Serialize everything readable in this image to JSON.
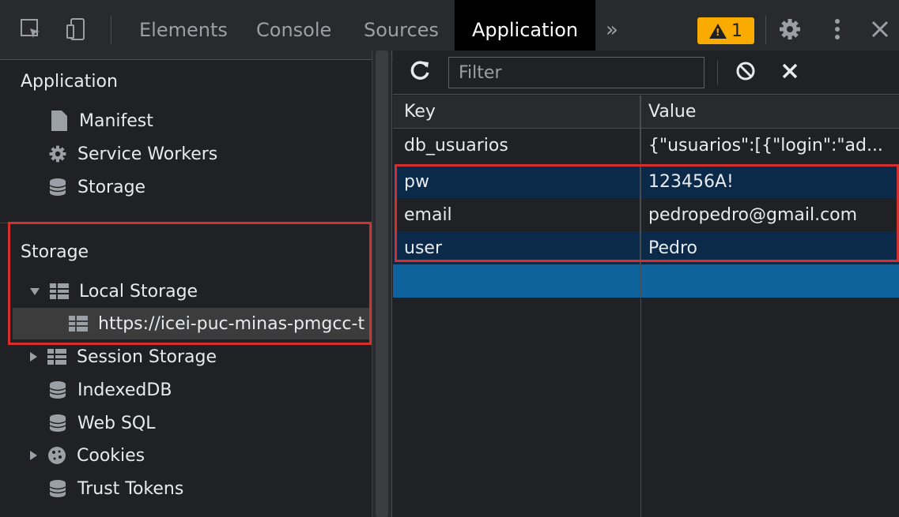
{
  "tabs": {
    "elements": "Elements",
    "console": "Console",
    "sources": "Sources",
    "application": "Application",
    "more": "»",
    "warning_count": "1"
  },
  "sidebar": {
    "application_title": "Application",
    "app_items": [
      "Manifest",
      "Service Workers",
      "Storage"
    ],
    "storage_title": "Storage",
    "local_storage": "Local Storage",
    "local_storage_origin": "https://icei-puc-minas-pmgcc-t",
    "storage_items": [
      "Session Storage",
      "IndexedDB",
      "Web SQL",
      "Cookies",
      "Trust Tokens"
    ]
  },
  "toolbar": {
    "filter_placeholder": "Filter"
  },
  "table": {
    "headers": {
      "key": "Key",
      "value": "Value"
    },
    "rows": [
      {
        "key": "db_usuarios",
        "value": "{\"usuarios\":[{\"login\":\"ad..."
      },
      {
        "key": "pw",
        "value": "123456A!"
      },
      {
        "key": "email",
        "value": "pedropedro@gmail.com"
      },
      {
        "key": "user",
        "value": "Pedro"
      }
    ]
  },
  "colors": {
    "accent_selected": "#0e639c",
    "highlight": "#d32f2f",
    "warning": "#f9ab00"
  }
}
